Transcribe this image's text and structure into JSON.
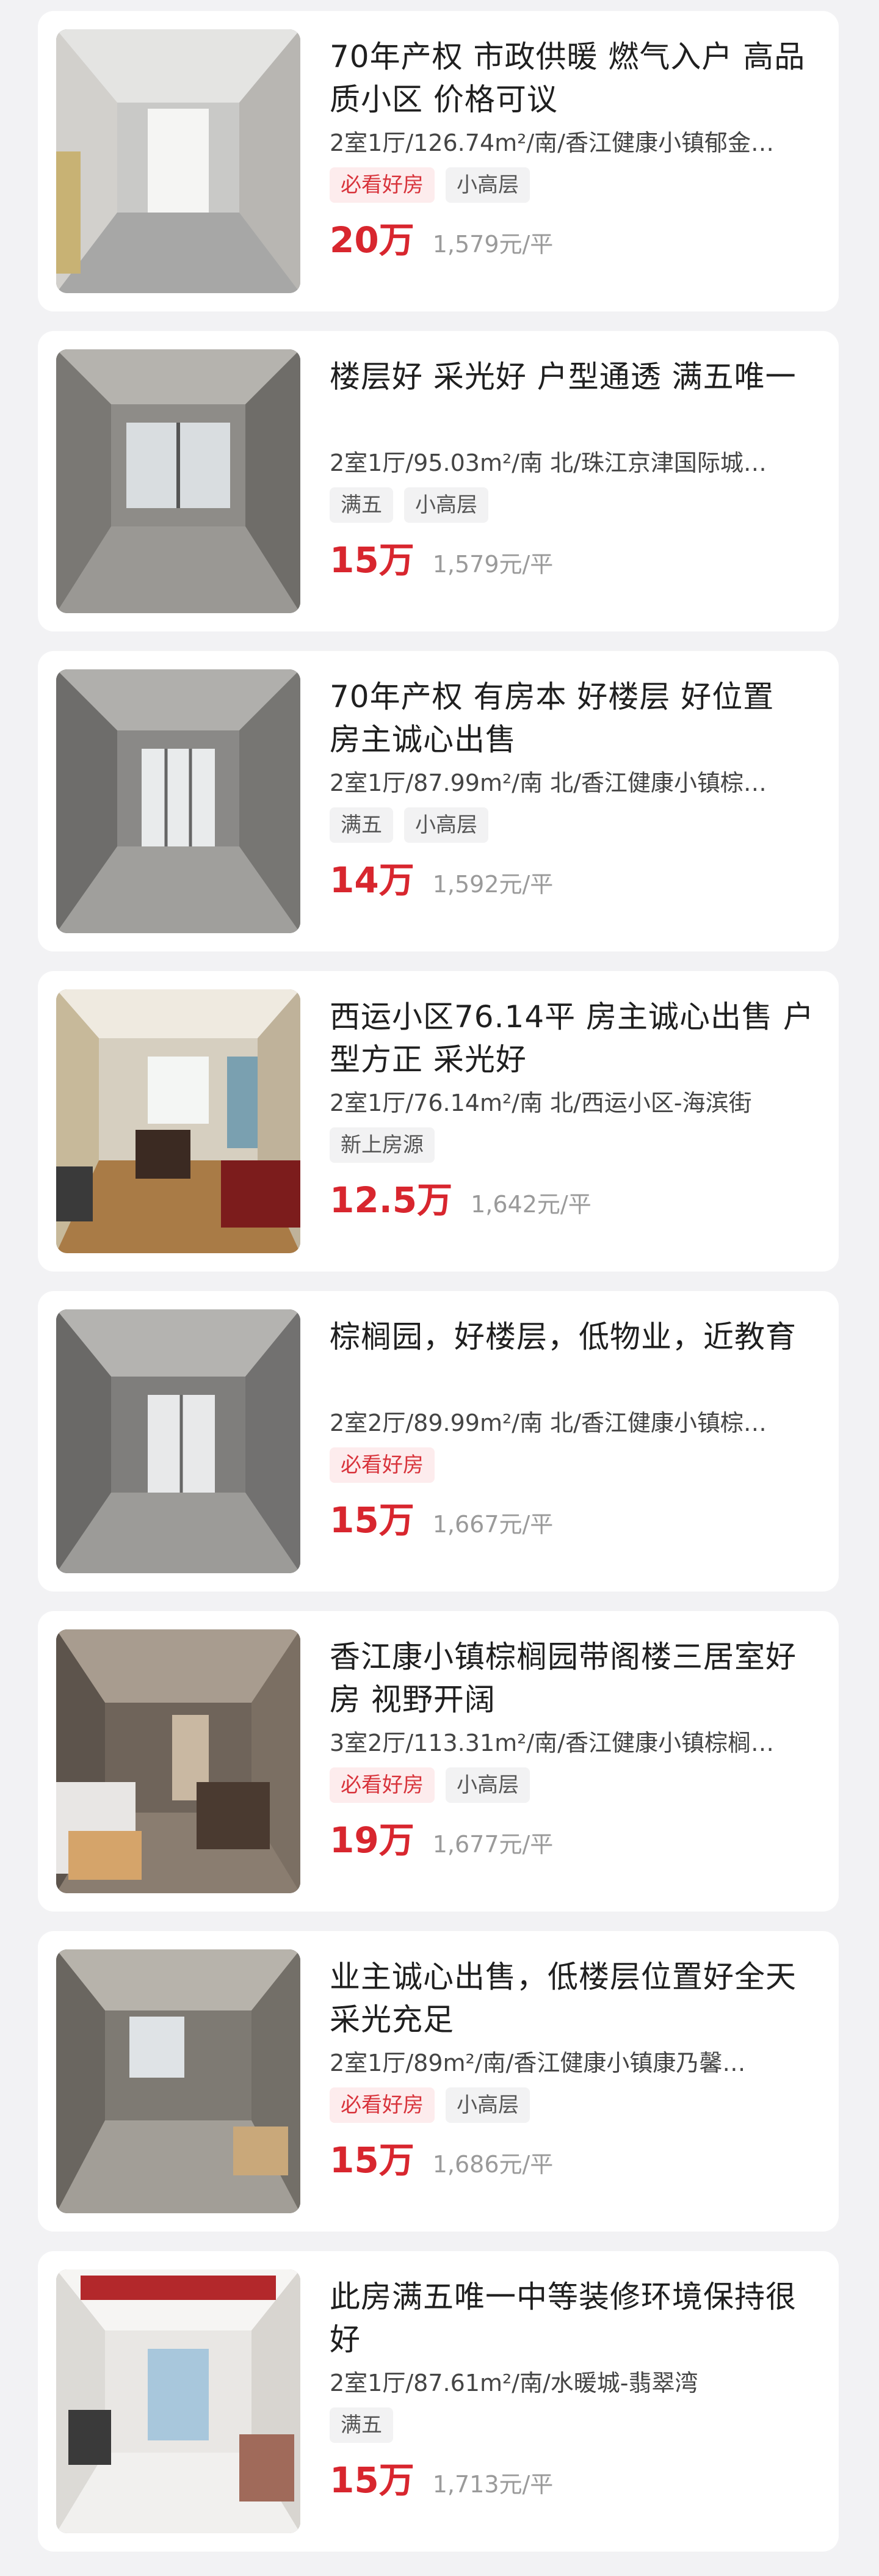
{
  "listings": [
    {
      "title": "70年产权 市政供暖 燃气入户 高品质小区 价格可议",
      "meta": "2室1厅/126.74m²/南/香江健康小镇郁金…",
      "tags": [
        "必看好房",
        "小高层"
      ],
      "tag_styles": [
        "hot",
        "plain"
      ],
      "price": "20万",
      "unit_price": "1,579元/平"
    },
    {
      "title": "楼层好  采光好  户型通透  满五唯一",
      "meta": "2室1厅/95.03m²/南 北/珠江京津国际城…",
      "tags": [
        "满五",
        "小高层"
      ],
      "tag_styles": [
        "plain",
        "plain"
      ],
      "price": "15万",
      "unit_price": "1,579元/平"
    },
    {
      "title": "70年产权 有房本 好楼层 好位置 房主诚心出售",
      "meta": "2室1厅/87.99m²/南 北/香江健康小镇棕…",
      "tags": [
        "满五",
        "小高层"
      ],
      "tag_styles": [
        "plain",
        "plain"
      ],
      "price": "14万",
      "unit_price": "1,592元/平"
    },
    {
      "title": "西运小区76.14平 房主诚心出售 户型方正 采光好",
      "meta": "2室1厅/76.14m²/南 北/西运小区-海滨街",
      "tags": [
        "新上房源"
      ],
      "tag_styles": [
        "plain"
      ],
      "price": "12.5万",
      "unit_price": "1,642元/平"
    },
    {
      "title": "棕榈园，好楼层，低物业，近教育",
      "meta": "2室2厅/89.99m²/南 北/香江健康小镇棕…",
      "tags": [
        "必看好房"
      ],
      "tag_styles": [
        "hot"
      ],
      "price": "15万",
      "unit_price": "1,667元/平"
    },
    {
      "title": "香江康小镇棕榈园带阁楼三居室好房   视野开阔",
      "meta": "3室2厅/113.31m²/南/香江健康小镇棕榈…",
      "tags": [
        "必看好房",
        "小高层"
      ],
      "tag_styles": [
        "hot",
        "plain"
      ],
      "price": "19万",
      "unit_price": "1,677元/平"
    },
    {
      "title": "业主诚心出售，低楼层位置好全天采光充足",
      "meta": "2室1厅/89m²/南/香江健康小镇康乃馨…",
      "tags": [
        "必看好房",
        "小高层"
      ],
      "tag_styles": [
        "hot",
        "plain"
      ],
      "price": "15万",
      "unit_price": "1,686元/平"
    },
    {
      "title": "此房满五唯一中等装修环境保持很好",
      "meta": "2室1厅/87.61m²/南/水暖城-翡翠湾",
      "tags": [
        "满五"
      ],
      "tag_styles": [
        "plain"
      ],
      "price": "15万",
      "unit_price": "1,713元/平"
    }
  ]
}
